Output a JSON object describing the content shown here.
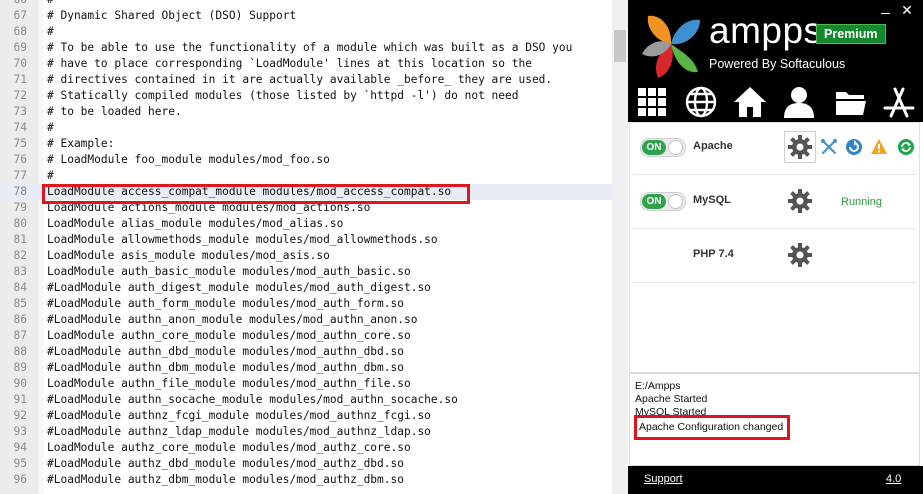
{
  "editor": {
    "current_line": "78",
    "lines": [
      {
        "num": "66",
        "text": "#"
      },
      {
        "num": "67",
        "text": "# Dynamic Shared Object (DSO) Support"
      },
      {
        "num": "68",
        "text": "#"
      },
      {
        "num": "69",
        "text": "# To be able to use the functionality of a module which was built as a DSO you"
      },
      {
        "num": "70",
        "text": "# have to place corresponding `LoadModule' lines at this location so the"
      },
      {
        "num": "71",
        "text": "# directives contained in it are actually available _before_ they are used."
      },
      {
        "num": "72",
        "text": "# Statically compiled modules (those listed by `httpd -l') do not need"
      },
      {
        "num": "73",
        "text": "# to be loaded here."
      },
      {
        "num": "74",
        "text": "#"
      },
      {
        "num": "75",
        "text": "# Example:"
      },
      {
        "num": "76",
        "text": "# LoadModule foo_module modules/mod_foo.so"
      },
      {
        "num": "77",
        "text": "#"
      },
      {
        "num": "78",
        "text": "LoadModule access_compat_module modules/mod_access_compat.so"
      },
      {
        "num": "79",
        "text": "LoadModule actions_module modules/mod_actions.so"
      },
      {
        "num": "80",
        "text": "LoadModule alias_module modules/mod_alias.so"
      },
      {
        "num": "81",
        "text": "LoadModule allowmethods_module modules/mod_allowmethods.so"
      },
      {
        "num": "82",
        "text": "LoadModule asis_module modules/mod_asis.so"
      },
      {
        "num": "83",
        "text": "LoadModule auth_basic_module modules/mod_auth_basic.so"
      },
      {
        "num": "84",
        "text": "#LoadModule auth_digest_module modules/mod_auth_digest.so"
      },
      {
        "num": "85",
        "text": "#LoadModule auth_form_module modules/mod_auth_form.so"
      },
      {
        "num": "86",
        "text": "#LoadModule authn_anon_module modules/mod_authn_anon.so"
      },
      {
        "num": "87",
        "text": "LoadModule authn_core_module modules/mod_authn_core.so"
      },
      {
        "num": "88",
        "text": "#LoadModule authn_dbd_module modules/mod_authn_dbd.so"
      },
      {
        "num": "89",
        "text": "#LoadModule authn_dbm_module modules/mod_authn_dbm.so"
      },
      {
        "num": "90",
        "text": "LoadModule authn_file_module modules/mod_authn_file.so"
      },
      {
        "num": "91",
        "text": "#LoadModule authn_socache_module modules/mod_authn_socache.so"
      },
      {
        "num": "92",
        "text": "#LoadModule authnz_fcgi_module modules/mod_authnz_fcgi.so"
      },
      {
        "num": "93",
        "text": "#LoadModule authnz_ldap_module modules/mod_authnz_ldap.so"
      },
      {
        "num": "94",
        "text": "LoadModule authz_core_module modules/mod_authz_core.so"
      },
      {
        "num": "95",
        "text": "#LoadModule authz_dbd_module modules/mod_authz_dbd.so"
      },
      {
        "num": "96",
        "text": "#LoadModule authz_dbm_module modules/mod_authz_dbm.so"
      }
    ]
  },
  "ampps": {
    "app_name": "ampps",
    "edition_badge": "Premium",
    "tagline": "Powered By Softaculous",
    "window_controls": {
      "close": "✕"
    },
    "nav_icons": [
      "apps-grid-icon",
      "globe-icon",
      "home-icon",
      "user-icon",
      "folder-icon",
      "app-store-icon"
    ],
    "services": [
      {
        "name": "Apache",
        "toggle": "ON",
        "status": ""
      },
      {
        "name": "MySQL",
        "toggle": "ON",
        "status": "Running"
      },
      {
        "name": "PHP 7.4",
        "toggle": "",
        "status": ""
      }
    ],
    "log": {
      "lines": [
        "E:/Ampps",
        "Apache Started",
        "MySQL Started"
      ],
      "highlighted": "Apache Configuration changed"
    },
    "footer": {
      "support": "Support",
      "version": "4.0"
    }
  },
  "colors": {
    "annotation_red": "#e0141c",
    "toggle_green": "#2fa24b",
    "premium_green": "#12892c",
    "running_green": "#2a9a3a",
    "current_line_bg": "#e8ecf6"
  }
}
